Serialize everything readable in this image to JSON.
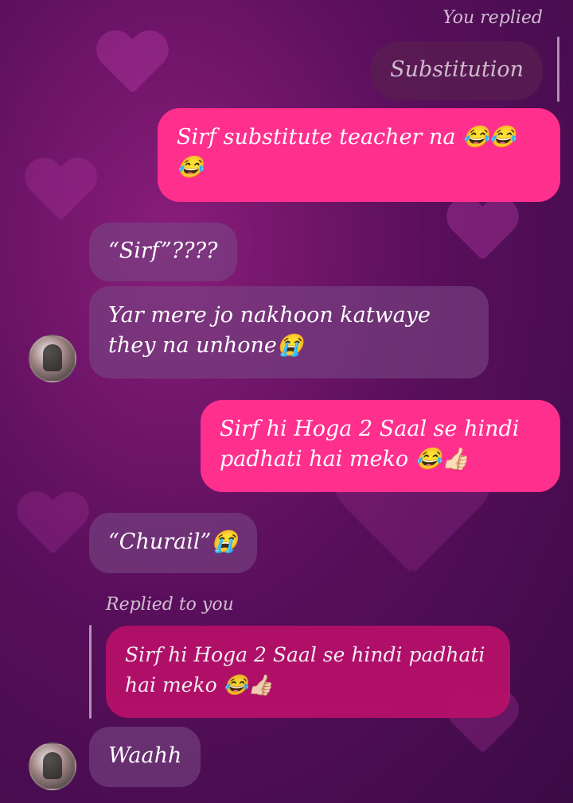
{
  "messages": [
    {
      "label": "You replied",
      "text": "Substitution"
    },
    {
      "text": "Sirf substitute teacher na 😂😂😂"
    },
    {
      "text": "“Sirf”????"
    },
    {
      "text": "Yar mere jo nakhoon katwaye they na unhone😭"
    },
    {
      "text": "Sirf hi Hoga 2 Saal se hindi padhati hai meko 😂👍🏻"
    },
    {
      "text": "“Churail”😭"
    },
    {
      "label": "Replied to you",
      "text": "Sirf hi Hoga 2 Saal se hindi padhati hai meko 😂👍🏻"
    },
    {
      "text": "Waahh"
    }
  ],
  "colors": {
    "outgoing_bubble": "#ff2f8e",
    "incoming_bubble": "#78468280",
    "reply_in_bubble": "#b8106a",
    "background_top": "#8a1d7a",
    "background_bottom": "#3b0a45"
  }
}
